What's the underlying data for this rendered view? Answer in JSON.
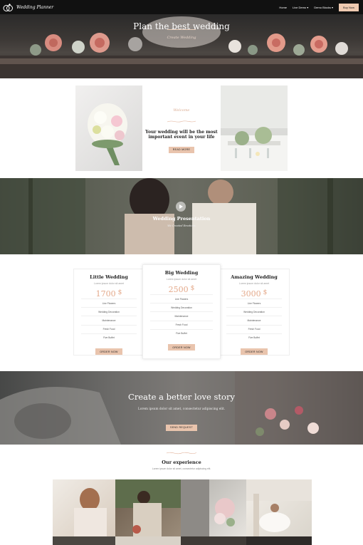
{
  "nav": {
    "brand": "Wedding Planner",
    "items": [
      "Home",
      "Live Demo",
      "Demo Blocks"
    ],
    "buy_label": "Buy Now"
  },
  "hero": {
    "title": "Plan the best wedding",
    "subtitle": "Create Wedding"
  },
  "welcome": {
    "script": "Welcome",
    "title": "Your wedding will be the most important event in your life",
    "button": "READ MORE"
  },
  "video": {
    "title": "Wedding Presentation",
    "subtitle": "We Created Emotions"
  },
  "pricing": [
    {
      "title": "Little Wedding",
      "desc": "Lorem ipsum dolor sit amet",
      "price": "1700",
      "currency": "$",
      "features": [
        "Live Flowers",
        "Wedding Decoration",
        "Maintenance",
        "Fresh Food",
        "Five Buffet"
      ],
      "button": "ORDER NOW"
    },
    {
      "title": "Big Wedding",
      "desc": "Lorem ipsum dolor sit amet",
      "price": "2500",
      "currency": "$",
      "features": [
        "Live Flowers",
        "Wedding Decoration",
        "Maintenance",
        "Fresh Food",
        "Five Buffet"
      ],
      "button": "ORDER NOW"
    },
    {
      "title": "Amazing Wedding",
      "desc": "Lorem ipsum dolor sit amet",
      "price": "3000",
      "currency": "$",
      "features": [
        "Live Flowers",
        "Wedding Decoration",
        "Maintenance",
        "Fresh Food",
        "Five Buffet"
      ],
      "button": "ORDER NOW"
    }
  ],
  "love": {
    "title": "Create a better love story",
    "subtitle": "Lorem ipsum dolor sit amet, consectetur adipiscing elit.",
    "button": "SEND REQUEST"
  },
  "experience": {
    "title": "Our experience",
    "subtitle": "Lorem ipsum dolor sit amet, consectetur adipiscing elit."
  },
  "colors": {
    "accent": "#e9c4ad",
    "price": "#e4a98a",
    "nav_bg": "#111111"
  }
}
